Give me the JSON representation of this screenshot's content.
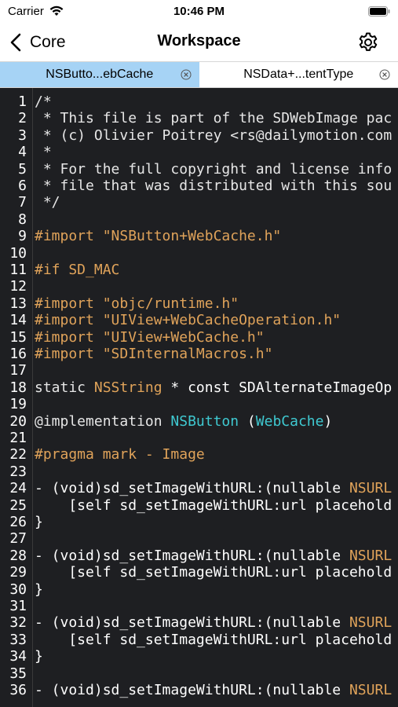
{
  "status_bar": {
    "carrier": "Carrier",
    "time": "10:46 PM"
  },
  "nav": {
    "back_label": "Core",
    "title": "Workspace",
    "icons": {
      "back": "chevron-left-icon",
      "settings": "gear-icon"
    }
  },
  "tabs": [
    {
      "label": "NSButto...ebCache",
      "active": true
    },
    {
      "label": "NSData+...tentType",
      "active": false
    }
  ],
  "editor": {
    "lines": [
      {
        "n": "1",
        "segments": [
          {
            "t": "/*",
            "c": "comment"
          }
        ]
      },
      {
        "n": "2",
        "segments": [
          {
            "t": " * This file is part of the SDWebImage pac",
            "c": "comment"
          }
        ]
      },
      {
        "n": "3",
        "segments": [
          {
            "t": " * (c) Olivier Poitrey <rs@dailymotion.com",
            "c": "comment"
          }
        ]
      },
      {
        "n": "4",
        "segments": [
          {
            "t": " *",
            "c": "comment"
          }
        ]
      },
      {
        "n": "5",
        "segments": [
          {
            "t": " * For the full copyright and license info",
            "c": "comment"
          }
        ]
      },
      {
        "n": "6",
        "segments": [
          {
            "t": " * file that was distributed with this sou",
            "c": "comment"
          }
        ]
      },
      {
        "n": "7",
        "segments": [
          {
            "t": " */",
            "c": "comment"
          }
        ]
      },
      {
        "n": "8",
        "segments": []
      },
      {
        "n": "9",
        "segments": [
          {
            "t": "#import \"NSButton+WebCache.h\"",
            "c": "directive"
          }
        ]
      },
      {
        "n": "10",
        "segments": []
      },
      {
        "n": "11",
        "segments": [
          {
            "t": "#if SD_MAC",
            "c": "directive"
          }
        ]
      },
      {
        "n": "12",
        "segments": []
      },
      {
        "n": "13",
        "segments": [
          {
            "t": "#import \"objc/runtime.h\"",
            "c": "directive"
          }
        ]
      },
      {
        "n": "14",
        "segments": [
          {
            "t": "#import \"UIView+WebCacheOperation.h\"",
            "c": "directive"
          }
        ]
      },
      {
        "n": "15",
        "segments": [
          {
            "t": "#import \"UIView+WebCache.h\"",
            "c": "directive"
          }
        ]
      },
      {
        "n": "16",
        "segments": [
          {
            "t": "#import \"SDInternalMacros.h\"",
            "c": "directive"
          }
        ]
      },
      {
        "n": "17",
        "segments": []
      },
      {
        "n": "18",
        "segments": [
          {
            "t": "static ",
            "c": "keyword"
          },
          {
            "t": "NSString",
            "c": "class"
          },
          {
            "t": " * const SDAlternateImageOp",
            "c": "plain"
          }
        ]
      },
      {
        "n": "19",
        "segments": []
      },
      {
        "n": "20",
        "segments": [
          {
            "t": "@implementation ",
            "c": "keyword"
          },
          {
            "t": "NSButton",
            "c": "type"
          },
          {
            "t": " (",
            "c": "plain"
          },
          {
            "t": "WebCache",
            "c": "type"
          },
          {
            "t": ")",
            "c": "plain"
          }
        ]
      },
      {
        "n": "21",
        "segments": []
      },
      {
        "n": "22",
        "segments": [
          {
            "t": "#pragma mark - Image",
            "c": "directive"
          }
        ]
      },
      {
        "n": "23",
        "segments": []
      },
      {
        "n": "24",
        "segments": [
          {
            "t": "- (void)sd_setImageWithURL:(nullable ",
            "c": "plain"
          },
          {
            "t": "NSURL",
            "c": "class"
          }
        ]
      },
      {
        "n": "25",
        "segments": [
          {
            "t": "    [self sd_setImageWithURL:url placehold",
            "c": "plain"
          }
        ]
      },
      {
        "n": "26",
        "segments": [
          {
            "t": "}",
            "c": "plain"
          }
        ]
      },
      {
        "n": "27",
        "segments": []
      },
      {
        "n": "28",
        "segments": [
          {
            "t": "- (void)sd_setImageWithURL:(nullable ",
            "c": "plain"
          },
          {
            "t": "NSURL",
            "c": "class"
          }
        ]
      },
      {
        "n": "29",
        "segments": [
          {
            "t": "    [self sd_setImageWithURL:url placehold",
            "c": "plain"
          }
        ]
      },
      {
        "n": "30",
        "segments": [
          {
            "t": "}",
            "c": "plain"
          }
        ]
      },
      {
        "n": "31",
        "segments": []
      },
      {
        "n": "32",
        "segments": [
          {
            "t": "- (void)sd_setImageWithURL:(nullable ",
            "c": "plain"
          },
          {
            "t": "NSURL",
            "c": "class"
          }
        ]
      },
      {
        "n": "33",
        "segments": [
          {
            "t": "    [self sd_setImageWithURL:url placehold",
            "c": "plain"
          }
        ]
      },
      {
        "n": "34",
        "segments": [
          {
            "t": "}",
            "c": "plain"
          }
        ]
      },
      {
        "n": "35",
        "segments": []
      },
      {
        "n": "36",
        "segments": [
          {
            "t": "- (void)sd_setImageWithURL:(nullable ",
            "c": "plain"
          },
          {
            "t": "NSURL",
            "c": "class"
          }
        ]
      }
    ]
  },
  "colors": {
    "editor_bg": "#1e1f22",
    "active_tab": "#a6d3f5",
    "directive": "#e0a35a",
    "type": "#3fc9d1"
  }
}
